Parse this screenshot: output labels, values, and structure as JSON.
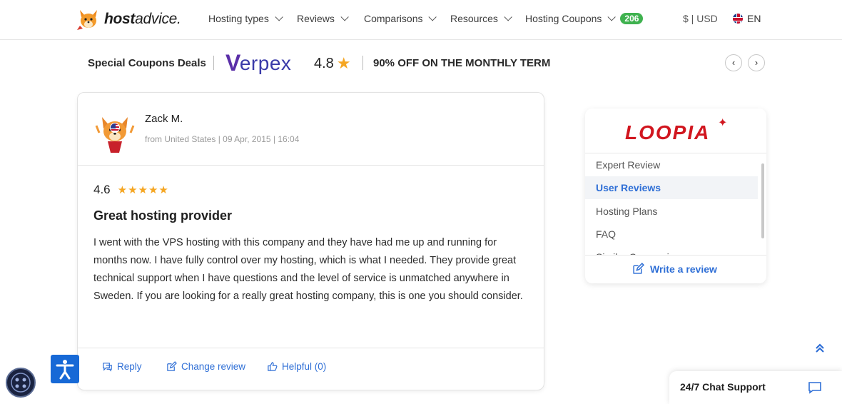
{
  "header": {
    "logo_text_bold": "host",
    "logo_text_rest": "advice.",
    "nav": [
      {
        "label": "Hosting types"
      },
      {
        "label": "Reviews"
      },
      {
        "label": "Comparisons"
      },
      {
        "label": "Resources"
      },
      {
        "label": "Hosting Coupons",
        "badge": "206"
      }
    ],
    "currency": "$ | USD",
    "language": "EN"
  },
  "coupons_bar": {
    "title": "Special Coupons Deals",
    "brand": "erpex",
    "brand_mark": "V",
    "score": "4.8",
    "deal": "90% OFF ON THE MONTHLY TERM",
    "prev_icon": "chevron-left-icon",
    "next_icon": "chevron-right-icon"
  },
  "review": {
    "author": "Zack M.",
    "meta": "from United States | 09 Apr, 2015 | 16:04",
    "rating": "4.6",
    "stars": "★★★★★",
    "title": "Great hosting provider",
    "body": "I went with the VPS hosting with this company and they have had me up and running for months now. I have fully control over my hosting, which is what I needed. They provide great technical support when I have questions and the level of service is unmatched anywhere in Sweden. If you are looking for a really great hosting company, this is one you should consider.",
    "actions": {
      "reply": "Reply",
      "change": "Change review",
      "helpful": "Helpful (0)"
    }
  },
  "sidebar": {
    "brand": "LOOPIA",
    "items": [
      {
        "label": "Expert Review"
      },
      {
        "label": "User Reviews"
      },
      {
        "label": "Hosting Plans"
      },
      {
        "label": "FAQ"
      },
      {
        "label": "Similar Companies"
      }
    ],
    "write_review": "Write a review"
  },
  "chat": {
    "label": "24/7 Chat Support"
  },
  "colors": {
    "accent_blue": "#2f6fd6",
    "badge_green": "#3fb24f",
    "star_gold": "#f5a623",
    "loopia_red": "#d1161f"
  }
}
